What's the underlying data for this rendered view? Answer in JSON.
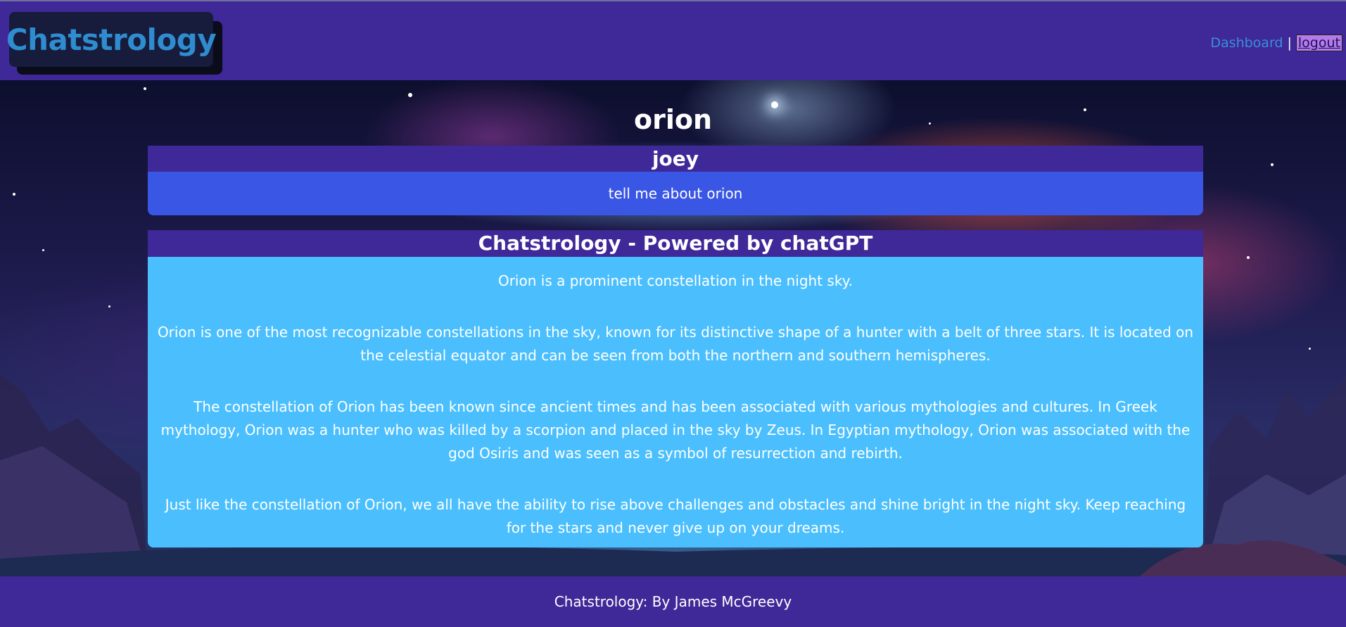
{
  "header": {
    "logo_text": "Chatstrology",
    "nav": {
      "dashboard_label": "Dashboard",
      "separator": "|",
      "logout_label": "logout"
    }
  },
  "main": {
    "title": "orion",
    "user_message": {
      "author": "joey",
      "text": "tell me about orion"
    },
    "ai_message": {
      "author": "Chatstrology - Powered by chatGPT",
      "paragraphs": [
        "Orion is a prominent constellation in the night sky.",
        "Orion is one of the most recognizable constellations in the sky, known for its distinctive shape of a hunter with a belt of three stars. It is located on the celestial equator and can be seen from both the northern and southern hemispheres.",
        "The constellation of Orion has been known since ancient times and has been associated with various mythologies and cultures. In Greek mythology, Orion was a hunter who was killed by a scorpion and placed in the sky by Zeus. In Egyptian mythology, Orion was associated with the god Osiris and was seen as a symbol of resurrection and rebirth.",
        "Just like the constellation of Orion, we all have the ability to rise above challenges and obstacles and shine bright in the night sky. Keep reaching for the stars and never give up on your dreams."
      ]
    }
  },
  "footer": {
    "text": "Chatstrology: By James McGreevy"
  },
  "colors": {
    "header_bg": "#3f2898",
    "logo_bg": "#171b3c",
    "logo_text": "#2e8ccf",
    "user_body_bg": "#3a56e5",
    "ai_body_bg": "#4bbffd",
    "logout_bg": "#b57ae8"
  }
}
